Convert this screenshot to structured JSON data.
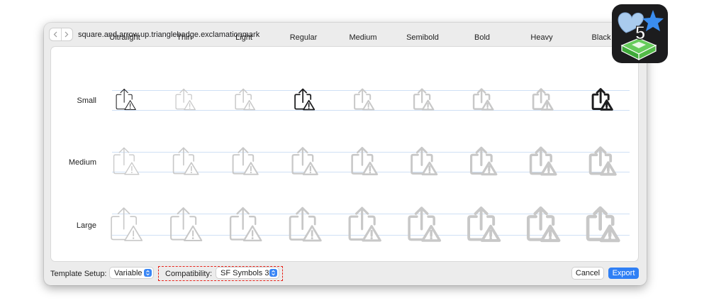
{
  "window": {
    "symbol_name": "square.and.arrow.up.trianglebadge.exclamationmark"
  },
  "grid": {
    "weights": [
      "Ultralight",
      "Thin",
      "Light",
      "Regular",
      "Medium",
      "Semibold",
      "Bold",
      "Heavy",
      "Black"
    ],
    "scales": [
      "Small",
      "Medium",
      "Large"
    ],
    "active_cells": [
      {
        "scale": "Small",
        "weight": "Ultralight"
      },
      {
        "scale": "Small",
        "weight": "Regular"
      },
      {
        "scale": "Small",
        "weight": "Black"
      }
    ]
  },
  "footer": {
    "template_setup_label": "Template Setup:",
    "template_setup_value": "Variable",
    "compatibility_label": "Compatibility:",
    "compatibility_value": "SF Symbols 3",
    "cancel_label": "Cancel",
    "export_label": "Export"
  },
  "badge": {
    "number": "5"
  },
  "colors": {
    "accent": "#2f7ff5",
    "highlight": "#e8241b",
    "guide_line": "#cfe0f5",
    "active_icon": "#1d1d1f",
    "inactive_icon": "#c8c8c8"
  }
}
